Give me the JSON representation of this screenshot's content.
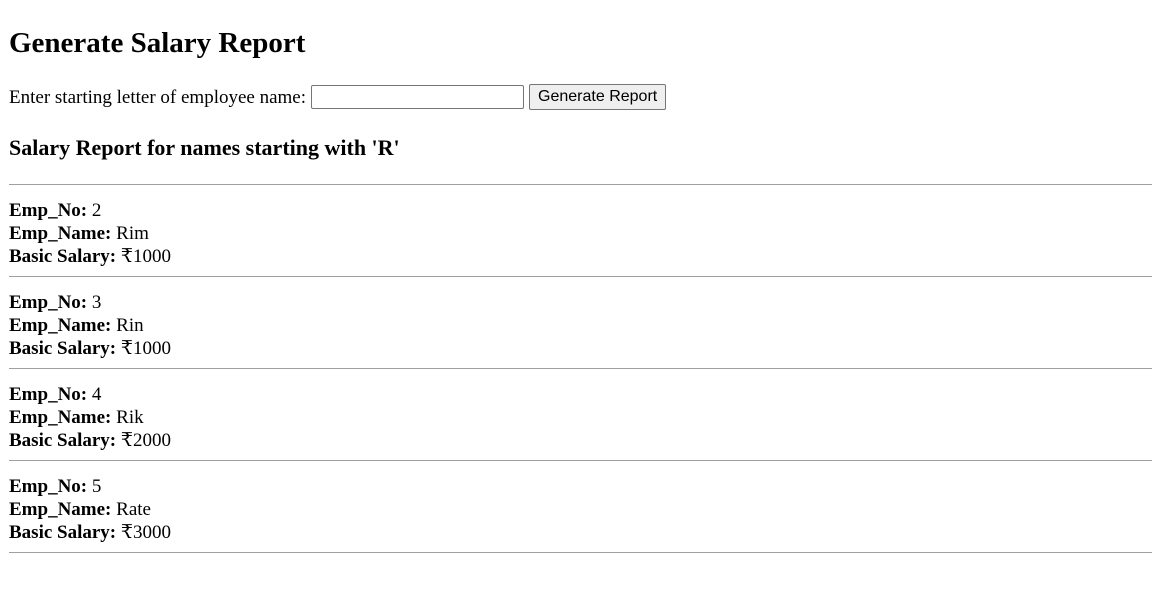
{
  "page": {
    "title": "Generate Salary Report"
  },
  "form": {
    "label": "Enter starting letter of employee name:",
    "input_value": "",
    "input_placeholder": "",
    "button_label": "Generate Report"
  },
  "report": {
    "heading": "Salary Report for names starting with 'R'",
    "labels": {
      "emp_no": "Emp_No:",
      "emp_name": "Emp_Name:",
      "salary": "Basic Salary:"
    },
    "records": [
      {
        "emp_no": "2",
        "emp_name": "Rim",
        "salary": "₹1000"
      },
      {
        "emp_no": "3",
        "emp_name": "Rin",
        "salary": "₹1000"
      },
      {
        "emp_no": "4",
        "emp_name": "Rik",
        "salary": "₹2000"
      },
      {
        "emp_no": "5",
        "emp_name": "Rate",
        "salary": "₹3000"
      }
    ]
  }
}
